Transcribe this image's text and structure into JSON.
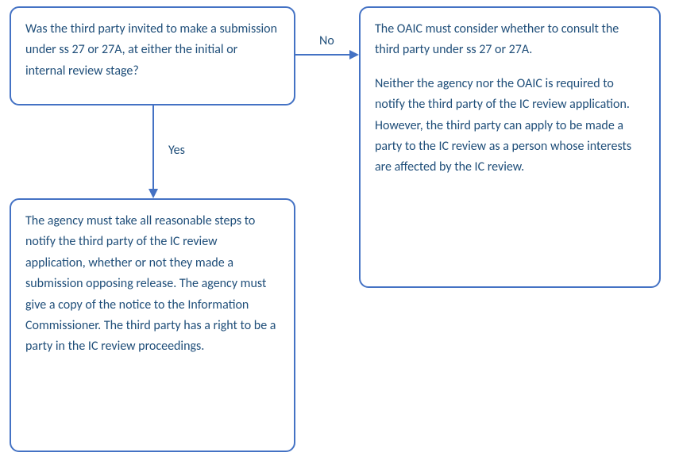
{
  "flowchart": {
    "question": {
      "text": "Was the third party invited to make a submission under ss 27 or 27A, at either the initial or internal review stage?"
    },
    "edges": {
      "no_label": "No",
      "yes_label": "Yes"
    },
    "outcome_no": {
      "p1": "The OAIC must consider whether to consult the third party under ss 27 or 27A.",
      "p2": "Neither the agency nor the OAIC is required to notify the third party of the IC review application. However, the third party can apply to be made a party to the IC review as a person whose interests are affected by the IC review."
    },
    "outcome_yes": {
      "text": "The agency must take all reasonable steps to notify the third party of the IC review application, whether or not they made a submission opposing release. The agency must give a copy of the notice to the Information Commissioner. The third party has a right to be a party in the IC review proceedings."
    }
  },
  "colors": {
    "border": "#4472C4",
    "text": "#1f4e79"
  }
}
